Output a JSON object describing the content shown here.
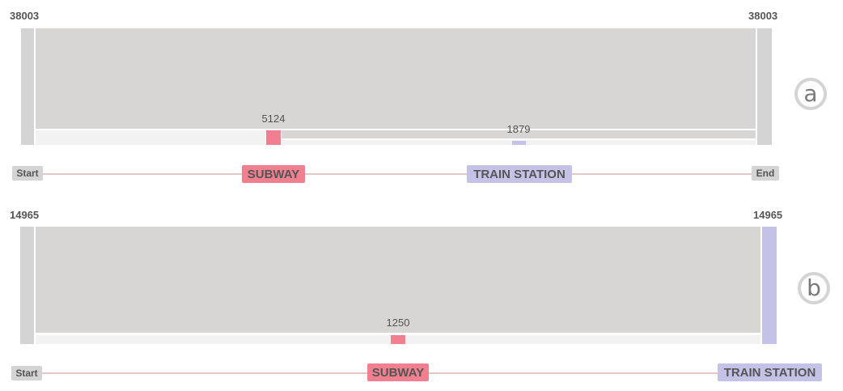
{
  "colors": {
    "flow_gray": "#d7d6d4",
    "light_gray": "#f2f2f2",
    "subway": "#f08090",
    "train_station": "#c4c2e6",
    "start_end": "#d4d4d4",
    "track": "#e3c7c7"
  },
  "panels": [
    {
      "badge": "a",
      "start_count": "38003",
      "end_count": "38003",
      "bars": [
        {
          "label": "5124",
          "value": 5124,
          "kind": "subway"
        },
        {
          "label": "1879",
          "value": 1879,
          "kind": "train_station"
        }
      ],
      "nodes": {
        "start": "Start",
        "subway": "SUBWAY",
        "train_station": "TRAIN STATION",
        "end": "End"
      }
    },
    {
      "badge": "b",
      "start_count": "14965",
      "end_count": "14965",
      "bars": [
        {
          "label": "1250",
          "value": 1250,
          "kind": "subway"
        }
      ],
      "nodes": {
        "start": "Start",
        "subway": "SUBWAY",
        "train_station": "TRAIN STATION"
      }
    }
  ]
}
